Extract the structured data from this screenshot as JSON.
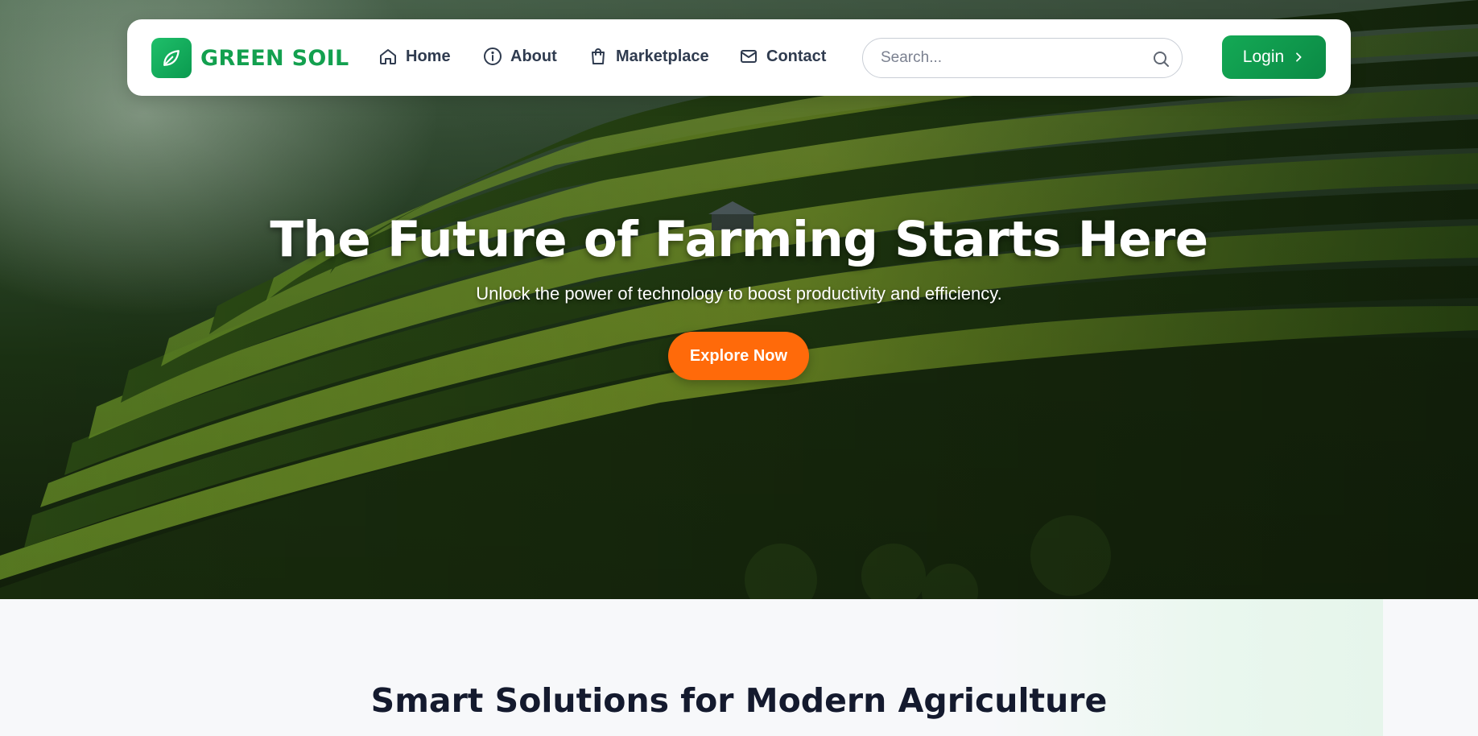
{
  "brand": {
    "name": "GREEN SOIL",
    "logo_icon": "leaf-icon",
    "color": "#13a04f"
  },
  "nav": {
    "items": [
      {
        "label": "Home",
        "icon": "home-icon"
      },
      {
        "label": "About",
        "icon": "info-icon"
      },
      {
        "label": "Marketplace",
        "icon": "shopping-bag-icon"
      },
      {
        "label": "Contact",
        "icon": "mail-icon"
      }
    ],
    "search_placeholder": "Search...",
    "search_icon": "search-icon",
    "login_label": "Login",
    "login_icon": "chevron-right-icon"
  },
  "hero": {
    "title": "The Future of Farming Starts Here",
    "subtitle": "Unlock the power of technology to boost productivity and efficiency.",
    "cta_label": "Explore Now",
    "background": "rice terrace landscape photo"
  },
  "section": {
    "title": "Smart Solutions for Modern Agriculture"
  },
  "colors": {
    "accent_green": "#0f9d4f",
    "cta_orange": "#ff6a0a",
    "nav_text": "#2f3b4f",
    "heading_dark": "#141a2e"
  }
}
